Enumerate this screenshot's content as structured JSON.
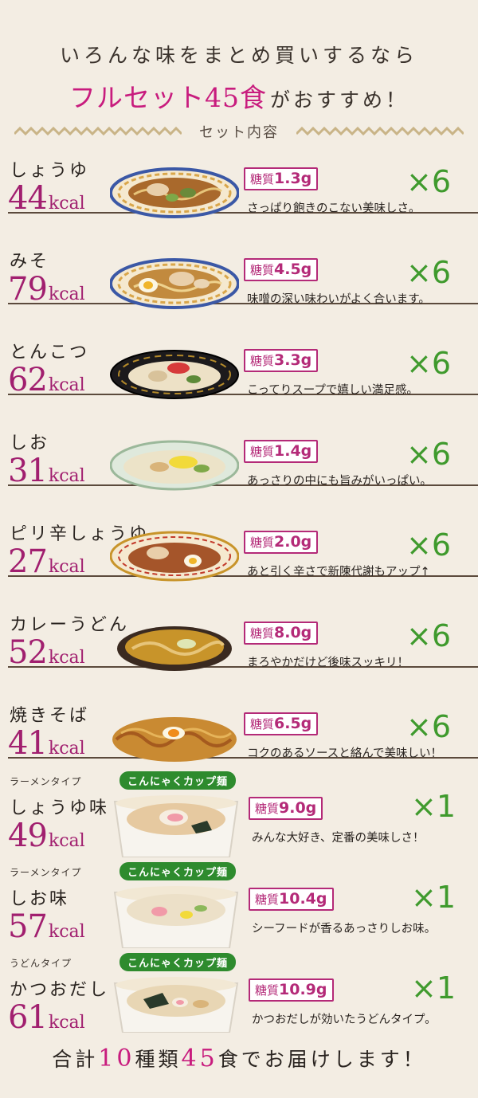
{
  "header": {
    "line1": "いろんな味をまとめ買いするなら",
    "highlight": "フルセット45食",
    "line2_rest": "がおすすめ！"
  },
  "set_label": "セット内容",
  "colors": {
    "pink": "#c81c7e",
    "green": "#3f9a2d",
    "beige": "#f3ede3",
    "zigzag": "#c9b487"
  },
  "items": [
    {
      "name": "しょうゆ",
      "kcal": "44",
      "unit": "kcal",
      "sugar_label": "糖質",
      "sugar_value": "1.3g",
      "desc": "さっぱり飽きのこない美味しさ。",
      "qty": "×6"
    },
    {
      "name": "みそ",
      "kcal": "79",
      "unit": "kcal",
      "sugar_label": "糖質",
      "sugar_value": "4.5g",
      "desc": "味噌の深い味わいがよく合います。",
      "qty": "×6"
    },
    {
      "name": "とんこつ",
      "kcal": "62",
      "unit": "kcal",
      "sugar_label": "糖質",
      "sugar_value": "3.3g",
      "desc": "こってりスープで嬉しい満足感。",
      "qty": "×6"
    },
    {
      "name": "しお",
      "kcal": "31",
      "unit": "kcal",
      "sugar_label": "糖質",
      "sugar_value": "1.4g",
      "desc": "あっさりの中にも旨みがいっぱい。",
      "qty": "×6"
    },
    {
      "name": "ピリ辛しょうゆ",
      "kcal": "27",
      "unit": "kcal",
      "sugar_label": "糖質",
      "sugar_value": "2.0g",
      "desc": "あと引く辛さで新陳代謝もアップ↑",
      "qty": "×6"
    },
    {
      "name": "カレーうどん",
      "kcal": "52",
      "unit": "kcal",
      "sugar_label": "糖質",
      "sugar_value": "8.0g",
      "desc": "まろやかだけど後味スッキリ！",
      "qty": "×6"
    },
    {
      "name": "焼きそば",
      "kcal": "41",
      "unit": "kcal",
      "sugar_label": "糖質",
      "sugar_value": "6.5g",
      "desc": "コクのあるソースと絡んで美味しい！",
      "qty": "×6"
    },
    {
      "sub": "ラーメンタイプ",
      "badge": "こんにゃくカップ麺",
      "name": "しょうゆ味",
      "kcal": "49",
      "unit": "kcal",
      "sugar_label": "糖質",
      "sugar_value": "9.0g",
      "desc": "みんな大好き、定番の美味しさ！",
      "qty": "×1"
    },
    {
      "sub": "ラーメンタイプ",
      "badge": "こんにゃくカップ麺",
      "name": "しお味",
      "kcal": "57",
      "unit": "kcal",
      "sugar_label": "糖質",
      "sugar_value": "10.4g",
      "desc": "シーフードが香るあっさりしお味。",
      "qty": "×1"
    },
    {
      "sub": "うどんタイプ",
      "badge": "こんにゃくカップ麺",
      "name": "かつおだし",
      "kcal": "61",
      "unit": "kcal",
      "sugar_label": "糖質",
      "sugar_value": "10.9g",
      "desc": "かつおだしが効いたうどんタイプ。",
      "qty": "×1"
    }
  ],
  "footer": {
    "prefix": "合計",
    "kinds_num": "10",
    "kinds_label": "種類",
    "meals_num": "45",
    "suffix": "食でお届けします！"
  }
}
